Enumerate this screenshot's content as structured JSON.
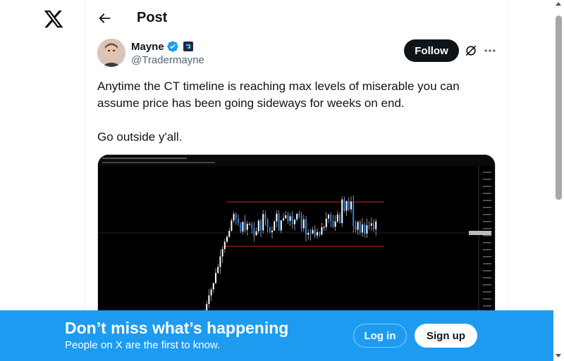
{
  "header": {
    "title": "Post"
  },
  "author": {
    "name": "Mayne",
    "handle": "@Tradermayne",
    "follow_label": "Follow"
  },
  "tweet": {
    "line1": "Anytime the CT timeline is reaching max levels of miserable you can assume price has been going sideways for weeks on end.",
    "line2": "Go outside y'all."
  },
  "signup_bar": {
    "headline": "Don’t miss what’s happening",
    "subtext": "People on X are the first to know.",
    "login_label": "Log in",
    "signup_label": "Sign up"
  },
  "colors": {
    "brand_blue": "#1d9bf0",
    "verified_blue": "#1d9bf0",
    "text_primary": "#0f1419",
    "text_secondary": "#536471",
    "range_line": "#8b1a1a"
  },
  "icons": {
    "logo": "x-logo-icon",
    "back": "arrow-left-icon",
    "verified": "verified-badge-icon",
    "affiliate": "affiliate-badge-icon",
    "grok": "grok-icon",
    "more": "more-horizontal-icon"
  }
}
